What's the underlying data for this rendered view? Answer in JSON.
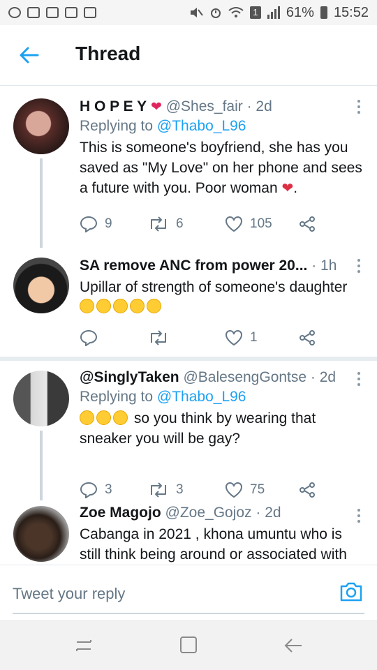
{
  "status_bar": {
    "battery_text": "61%",
    "time": "15:52",
    "notification_badge": "1",
    "left_icons": [
      "whatsapp-icon",
      "gmail-icon",
      "gmail-icon",
      "sim-icon",
      "gallery-icon"
    ],
    "right_icons": [
      "mute-icon",
      "alarm-icon",
      "wifi-icon",
      "sim-badge-icon",
      "signal-icon",
      "battery-icon"
    ]
  },
  "header": {
    "title": "Thread",
    "back_icon": "arrow-left-icon"
  },
  "tweets": [
    {
      "name": "H O P E Y",
      "handle": "@Shes_fair",
      "time": "· 2d",
      "replying_label": "Replying to",
      "replying_to": "@Thabo_L96",
      "text": "This is someone's boyfriend, she has you saved as \"My Love\" on her phone and sees a future with you. Poor woman",
      "text_end": ".",
      "replies": "9",
      "retweets": "6",
      "likes": "105"
    },
    {
      "name": "SA remove ANC from power 20...",
      "handle": "",
      "time": "· 1h",
      "text": "Upillar of strength of someone's daughter",
      "replies": "",
      "retweets": "",
      "likes": "1"
    },
    {
      "name": "@SinglyTaken",
      "handle": "@BalesengGontse",
      "time": "· 2d",
      "replying_label": "Replying to",
      "replying_to": "@Thabo_L96",
      "text": "so you think by wearing that sneaker you will be gay?",
      "replies": "3",
      "retweets": "3",
      "likes": "75"
    },
    {
      "name": "Zoe Magojo",
      "handle": "@Zoe_Gojoz",
      "time": "· 2d",
      "text": "Cabanga in 2021 , khona umuntu who is still think being around or associated with"
    }
  ],
  "reply_bar": {
    "placeholder": "Tweet your reply"
  },
  "colors": {
    "accent": "#1da1f2",
    "secondary_text": "#657786",
    "primary_text": "#14171a",
    "divider": "#e6ecf0",
    "broken_heart": "#dd2e44"
  },
  "nav_bar": {
    "icons": [
      "recents-icon",
      "home-icon",
      "back-icon"
    ]
  }
}
